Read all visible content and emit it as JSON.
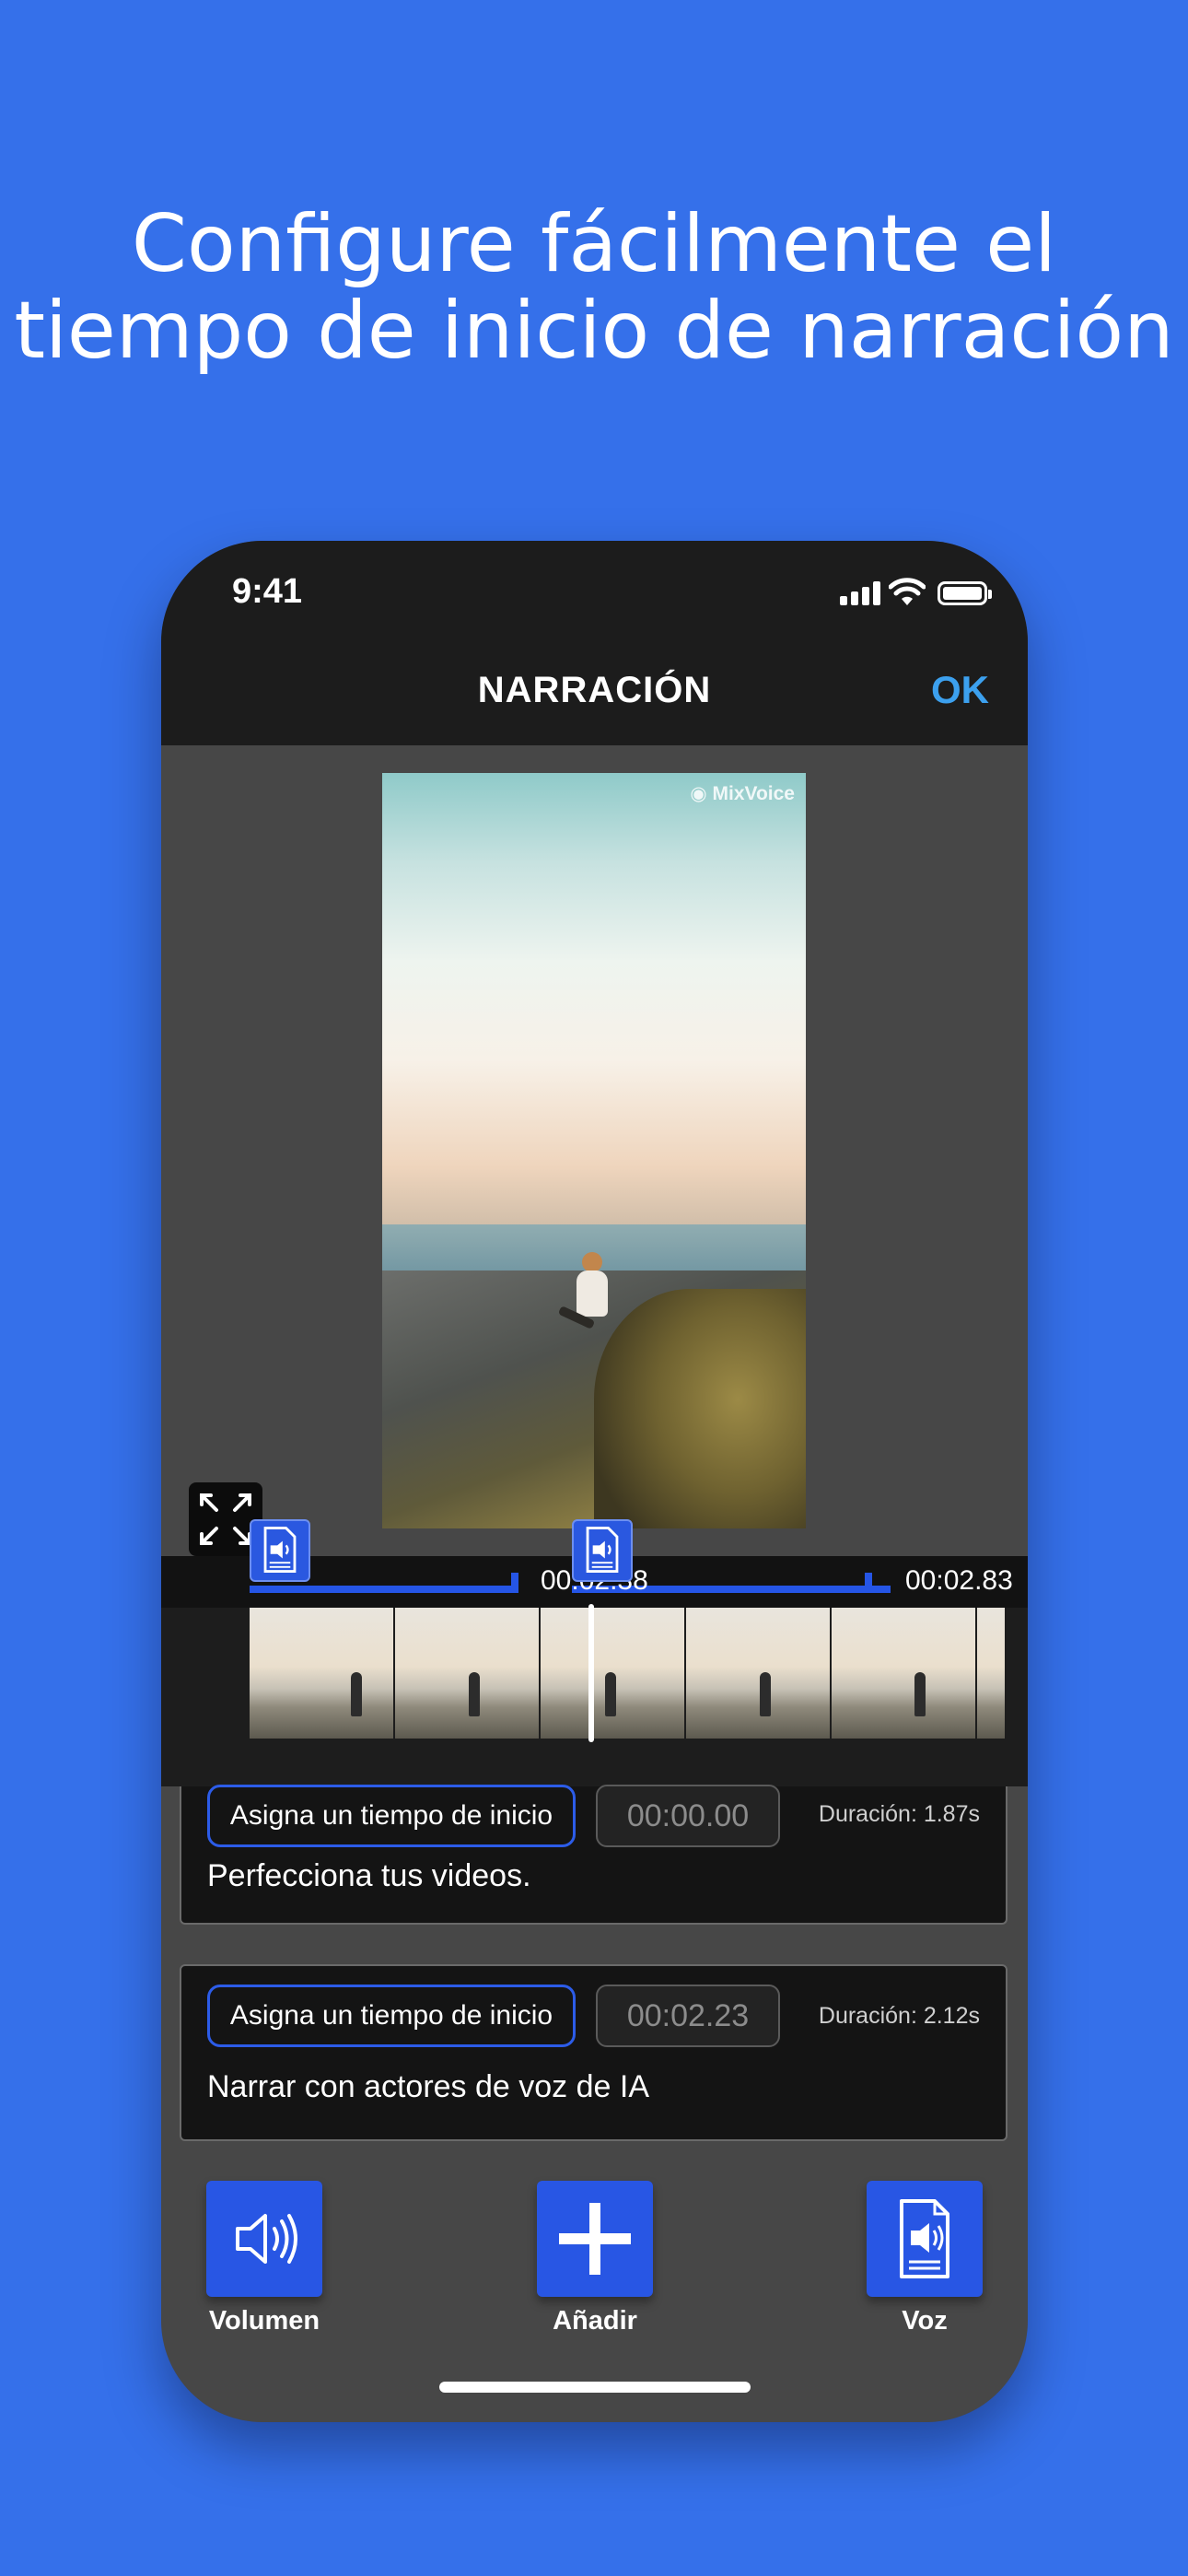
{
  "headline": {
    "line1": "Configure fácilmente el",
    "line2": "tiempo de inicio de narración"
  },
  "status_bar": {
    "time": "9:41"
  },
  "nav": {
    "title": "NARRACIÓN",
    "ok_label": "OK"
  },
  "video": {
    "watermark": "MixVoice"
  },
  "timeline": {
    "marker_time": "00:02.38",
    "end_time": "00:02.83"
  },
  "narrations": [
    {
      "set_start_label": "Asigna un tiempo de inicio",
      "start_time": "00:00.00",
      "duration": "Duración: 1.87s",
      "text": "Perfecciona tus videos."
    },
    {
      "set_start_label": "Asigna un tiempo de inicio",
      "start_time": "00:02.23",
      "duration": "Duración: 2.12s",
      "text": "Narrar con actores de voz de IA"
    }
  ],
  "toolbar": {
    "volume_label": "Volumen",
    "add_label": "Añadir",
    "voice_label": "Voz"
  },
  "colors": {
    "background": "#3570ea",
    "accent": "#2856e4",
    "ok": "#3ca0ee"
  }
}
